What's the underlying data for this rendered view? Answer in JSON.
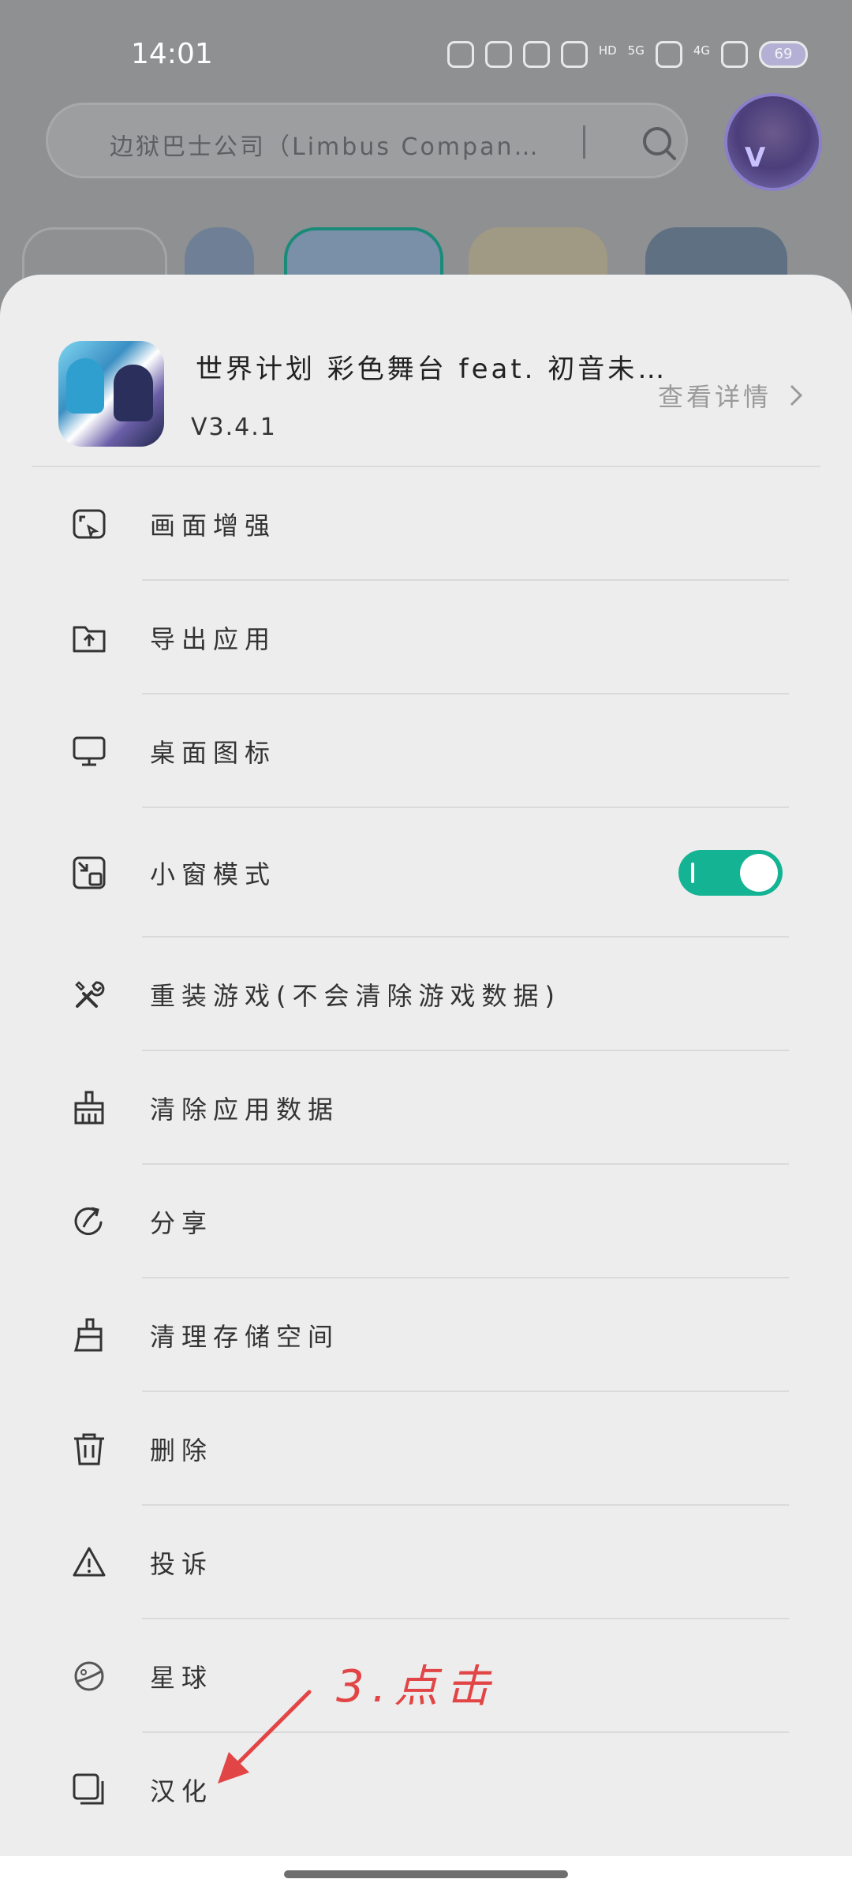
{
  "status_bar": {
    "time": "14:01",
    "signal_5g": "5G",
    "signal_4g": "4G",
    "hd": "HD",
    "battery": "69"
  },
  "search": {
    "text": "边狱巴士公司（Limbus Compan…"
  },
  "sheet": {
    "app_name": "世界计划 彩色舞台 feat. 初音未…",
    "version": "V3.4.1",
    "detail_label": "查看详情"
  },
  "menu": [
    {
      "label": "画面增强",
      "icon": "screen-enhance-icon"
    },
    {
      "label": "导出应用",
      "icon": "export-folder-icon"
    },
    {
      "label": "桌面图标",
      "icon": "monitor-icon"
    },
    {
      "label": "小窗模式",
      "icon": "floating-window-icon",
      "toggle_on": true
    },
    {
      "label": "重装游戏(不会清除游戏数据)",
      "icon": "tools-icon"
    },
    {
      "label": "清除应用数据",
      "icon": "broom-icon"
    },
    {
      "label": "分享",
      "icon": "share-icon"
    },
    {
      "label": "清理存储空间",
      "icon": "clean-brush-icon"
    },
    {
      "label": "删除",
      "icon": "trash-icon"
    },
    {
      "label": "投诉",
      "icon": "warning-icon"
    },
    {
      "label": "星球",
      "icon": "planet-icon"
    },
    {
      "label": "汉化",
      "icon": "copy-icon"
    }
  ],
  "annotation": {
    "text": "3.点击"
  },
  "colors": {
    "toggle_on": "#14b394",
    "annotation": "#e24545",
    "sheet_bg": "#ededed"
  }
}
